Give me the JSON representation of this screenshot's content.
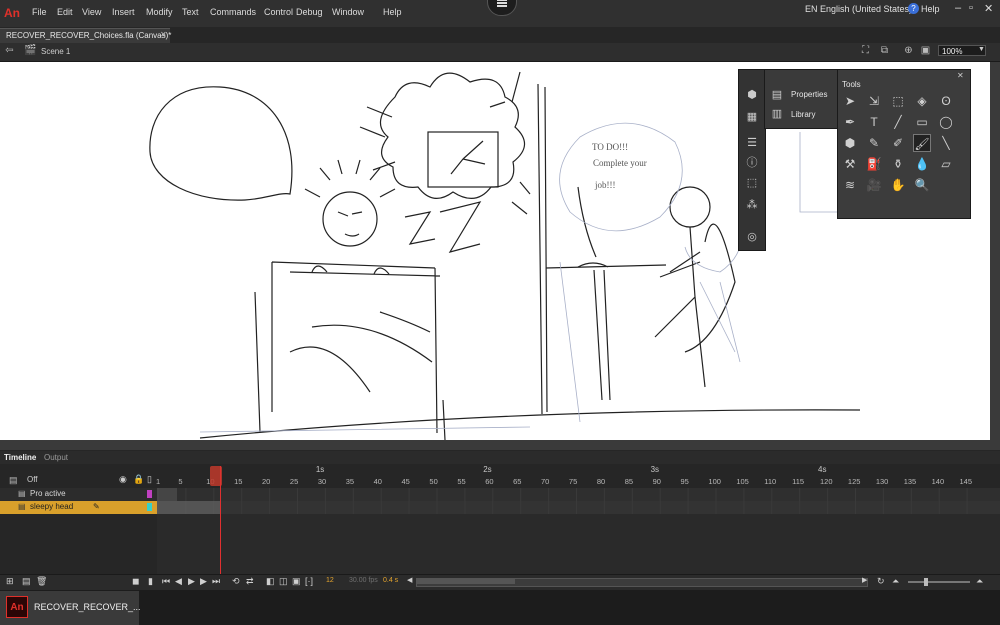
{
  "app": {
    "logo": "An",
    "accent": "#e0302a"
  },
  "menu": [
    "File",
    "Edit",
    "View",
    "Insert",
    "Modify",
    "Text",
    "Commands",
    "Control",
    "Debug",
    "Window",
    "Help"
  ],
  "workspace": {
    "language": "EN English (United States)",
    "help": "Help"
  },
  "document": {
    "tab_title": "RECOVER_RECOVER_Choices.fla (Canvas)*",
    "scene": "Scene 1",
    "zoom": "100%"
  },
  "stage": {
    "background": "#ffffff",
    "sketch_text": [
      "TO    DO!!!",
      "Complete your",
      "job!!!"
    ]
  },
  "panels": {
    "properties": "Properties",
    "library": "Library",
    "tools_title": "Tools",
    "tools": [
      "selection-tool",
      "subselection-tool",
      "free-transform-tool",
      "3d-rotation-tool",
      "lasso-tool",
      "pen-tool",
      "text-tool",
      "line-tool",
      "rectangle-tool",
      "oval-tool",
      "polystar-tool",
      "pencil-tool",
      "brush-tool",
      "paint-brush-tool",
      "brush-tool-2",
      "bone-tool",
      "paint-bucket-tool",
      "ink-bottle-tool",
      "eyedropper-tool",
      "eraser-tool",
      "width-tool",
      "camera-tool",
      "hand-tool",
      "zoom-tool"
    ]
  },
  "timeline": {
    "tabs": [
      "Timeline",
      "Output"
    ],
    "layers_header": "Off",
    "layers": [
      {
        "name": "Pro active",
        "color": "#c040c0",
        "selected": false
      },
      {
        "name": "sleepy head",
        "color": "#39d0c8",
        "selected": true
      }
    ],
    "seconds": [
      "1s",
      "2s",
      "3s",
      "4s"
    ],
    "frame_ticks": [
      "1",
      "5",
      "10",
      "15",
      "20",
      "25",
      "30",
      "35",
      "40",
      "45",
      "50",
      "55",
      "60",
      "65",
      "70",
      "75",
      "80",
      "85",
      "90",
      "95",
      "100",
      "105",
      "110",
      "115",
      "120",
      "125",
      "130",
      "135",
      "140",
      "145"
    ],
    "current_frame": "12",
    "fps": "30.00 fps",
    "elapsed": "0.4 s"
  },
  "taskbar": {
    "app_label": "RECOVER_RECOVER_..."
  }
}
